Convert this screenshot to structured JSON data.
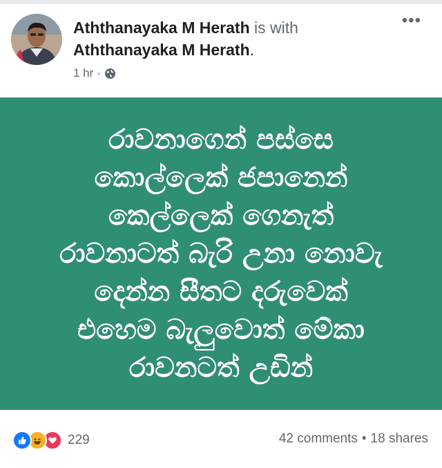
{
  "post": {
    "author": "Aththanayaka M Herath",
    "with_text": "is with",
    "tagged": "Aththanayaka M Herath",
    "tagged_suffix": ".",
    "time": "1 hr",
    "separator": "·",
    "privacy_icon": "globe-icon",
    "more_icon": "more-options-icon",
    "more_label": "•••",
    "background_color": "#2f8f74",
    "lines": [
      "රාවනාගෙන් පස්සෙ",
      "කොල්ලෙක් ජපානෙන්",
      "කෙල්ලෙක් ගෙනැත්",
      "රාවනාටත් බැරි උනා නොවැ",
      "දෙන්න සීතට දරුවෙක්",
      "එහෙම බැලුවොත් මේකා",
      "රාවනටත් උඩින්"
    ]
  },
  "footer": {
    "reaction_icons": [
      "like-icon",
      "haha-icon",
      "love-icon"
    ],
    "reaction_count": "229",
    "comments": "42 comments",
    "dot": "•",
    "shares": "18 shares"
  },
  "colors": {
    "like": "#1877f2",
    "haha": "#f7b125",
    "love": "#e8385b",
    "meta_text": "#606770"
  }
}
